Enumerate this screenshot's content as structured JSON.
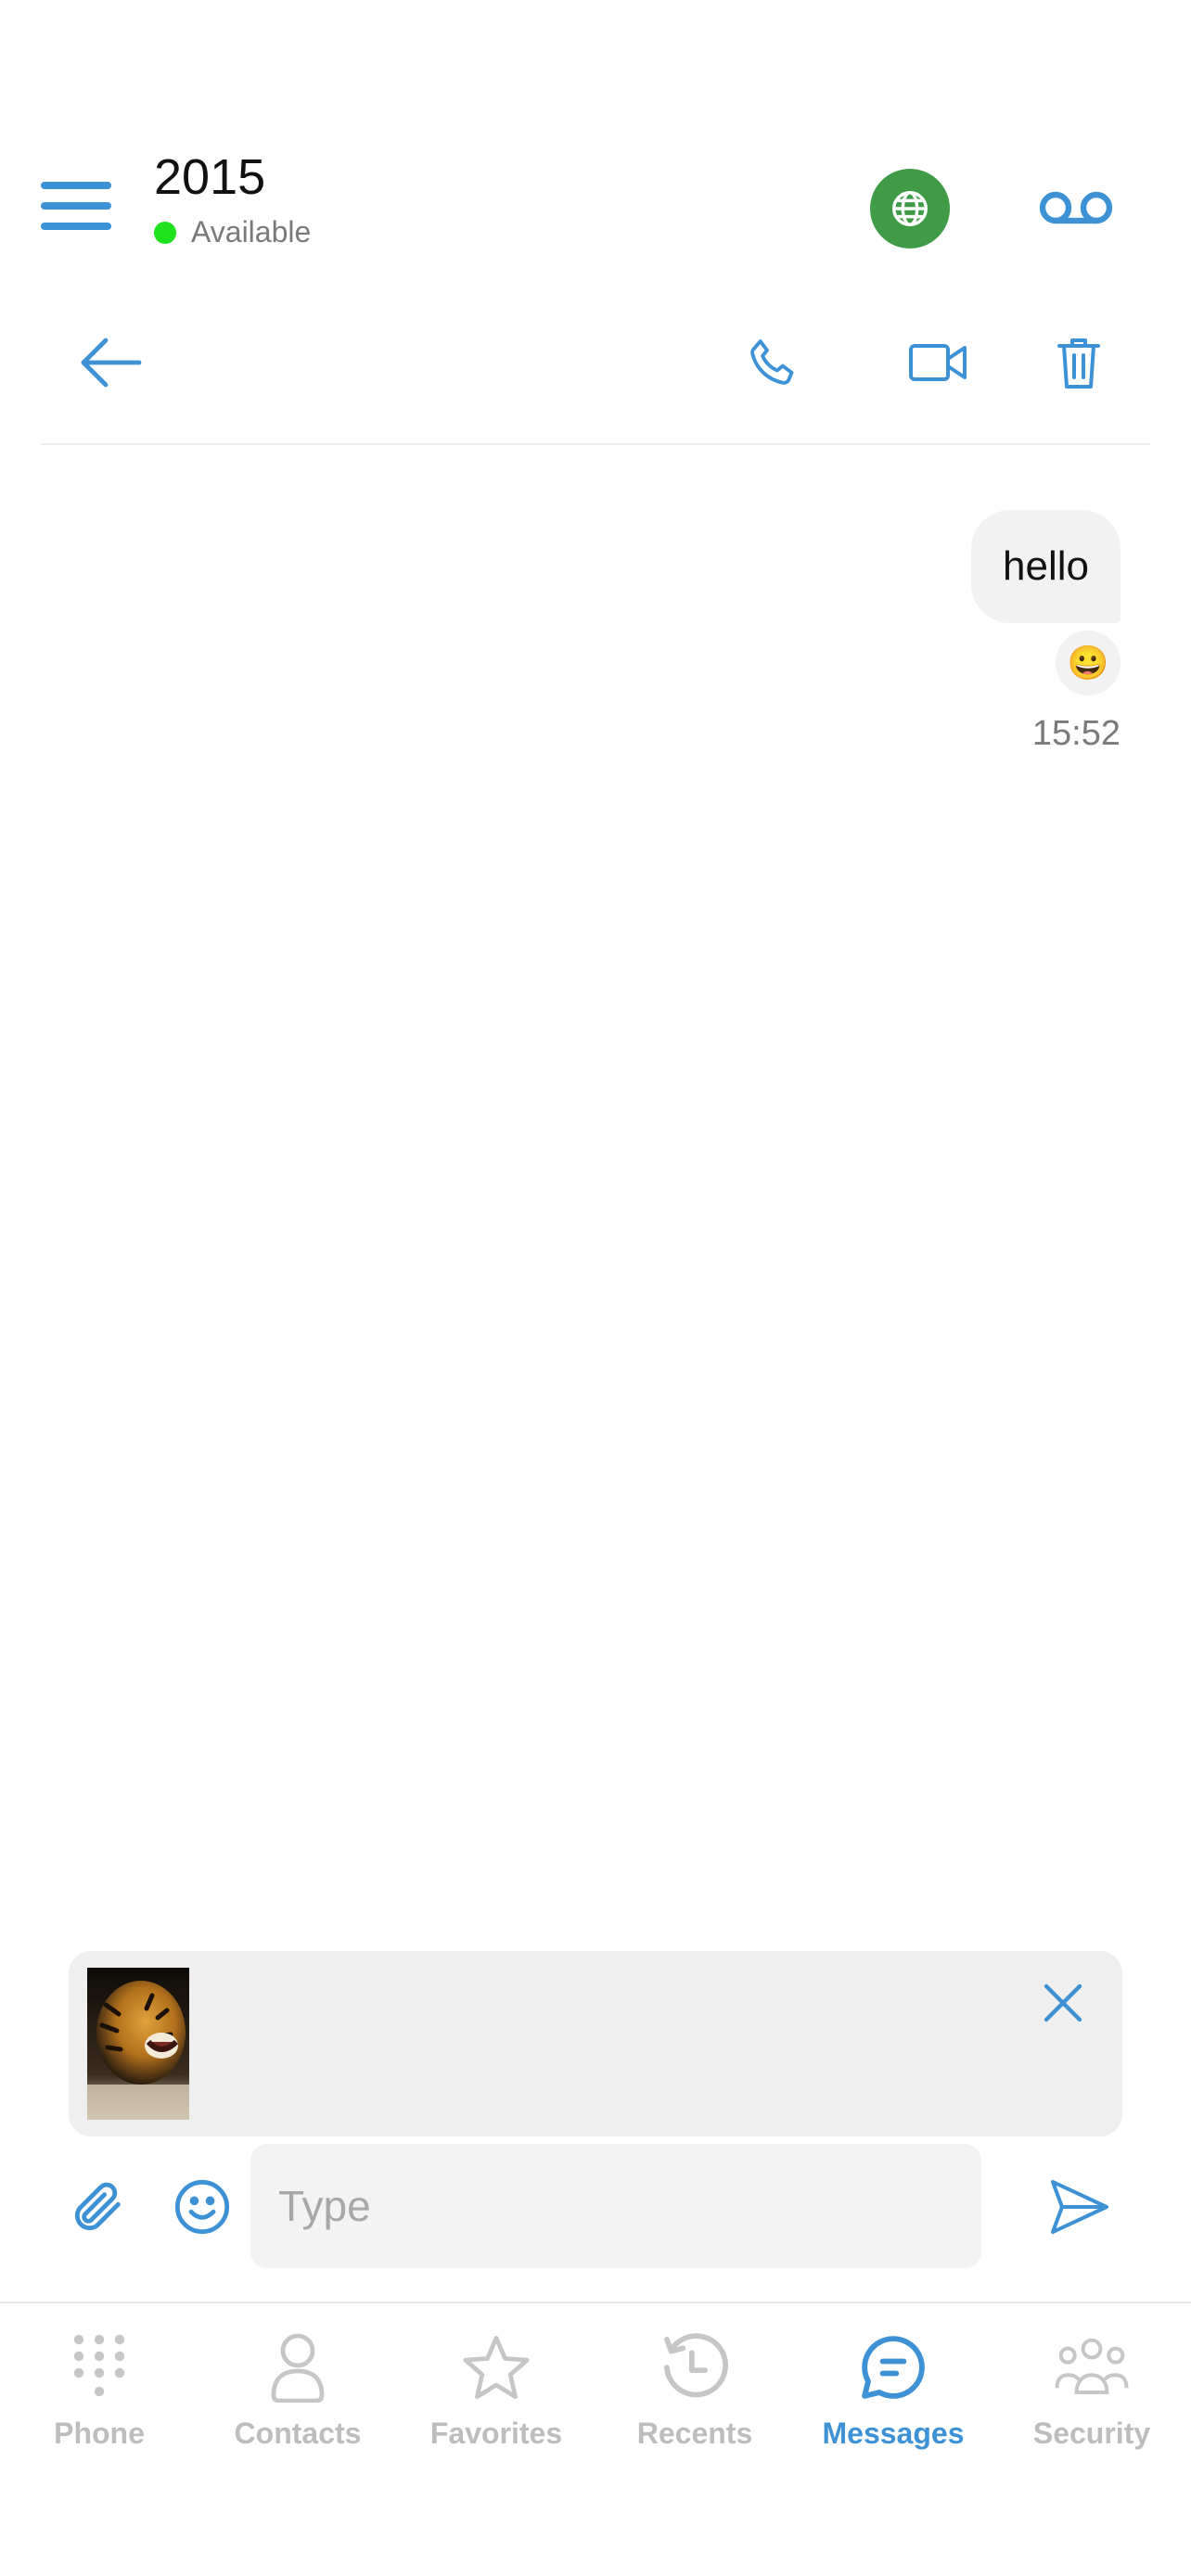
{
  "header": {
    "title": "2015",
    "status_text": "Available",
    "status_color": "#1ee21e",
    "globe_button_color": "#3f9b46",
    "accent_color": "#3d92d6"
  },
  "toolbar": {
    "icons": [
      "back-arrow-icon",
      "phone-icon",
      "video-camera-icon",
      "trash-icon"
    ]
  },
  "conversation": {
    "messages": [
      {
        "text": "hello",
        "reaction": "😀",
        "time": "15:52",
        "direction": "outgoing"
      }
    ]
  },
  "attachment": {
    "thumbnail": "tiger-photo",
    "remove_icon": "close-icon"
  },
  "compose": {
    "placeholder": "Type",
    "value": "",
    "icons": [
      "paperclip-icon",
      "smiley-icon",
      "send-icon"
    ]
  },
  "tabs": [
    {
      "label": "Phone",
      "icon": "dialpad-icon",
      "active": false
    },
    {
      "label": "Contacts",
      "icon": "person-icon",
      "active": false
    },
    {
      "label": "Favorites",
      "icon": "star-icon",
      "active": false
    },
    {
      "label": "Recents",
      "icon": "history-icon",
      "active": false
    },
    {
      "label": "Messages",
      "icon": "chat-bubble-icon",
      "active": true
    },
    {
      "label": "Security",
      "icon": "people-group-icon",
      "active": false
    }
  ]
}
